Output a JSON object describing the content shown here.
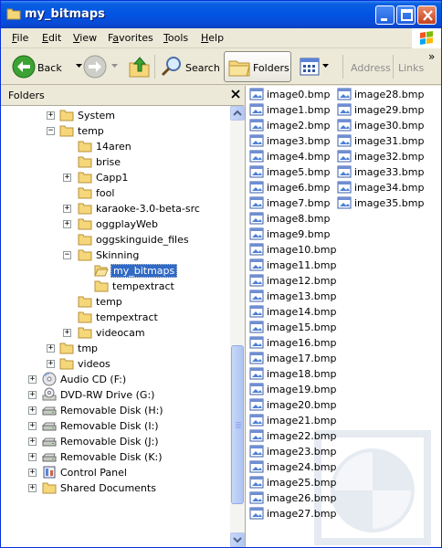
{
  "window": {
    "title": "my_bitmaps"
  },
  "menu": {
    "items": [
      {
        "u": "F",
        "rest": "ile"
      },
      {
        "u": "E",
        "rest": "dit"
      },
      {
        "u": "V",
        "rest": "iew"
      },
      {
        "u": "",
        "pre": "F",
        "u2": "a",
        "rest": "vorites"
      },
      {
        "u": "T",
        "rest": "ools"
      },
      {
        "u": "H",
        "rest": "elp"
      }
    ]
  },
  "toolbar": {
    "back": "Back",
    "search": "Search",
    "folders": "Folders",
    "address": "Address",
    "links": "Links",
    "chevron": "»"
  },
  "panel": {
    "title": "Folders",
    "close": "×"
  },
  "tree": [
    {
      "label": "System",
      "exp": "+"
    },
    {
      "label": "temp",
      "exp": "−"
    },
    {
      "label": "14aren",
      "exp": ""
    },
    {
      "label": "brise",
      "exp": ""
    },
    {
      "label": "Capp1",
      "exp": "+"
    },
    {
      "label": "fool",
      "exp": ""
    },
    {
      "label": "karaoke-3.0-beta-src",
      "exp": "+"
    },
    {
      "label": "oggplayWeb",
      "exp": "+"
    },
    {
      "label": "oggskinguide_files",
      "exp": ""
    },
    {
      "label": "Skinning",
      "exp": "−"
    },
    {
      "label": "my_bitmaps",
      "exp": "",
      "selected": true
    },
    {
      "label": "tempextract",
      "exp": ""
    },
    {
      "label": "temp",
      "exp": ""
    },
    {
      "label": "tempextract",
      "exp": ""
    },
    {
      "label": "videocam",
      "exp": "+"
    },
    {
      "label": "tmp",
      "exp": "+"
    },
    {
      "label": "videos",
      "exp": "+"
    },
    {
      "label": "Audio CD (F:)",
      "exp": "+",
      "icon": "cd"
    },
    {
      "label": "DVD-RW Drive (G:)",
      "exp": "+",
      "icon": "dvd"
    },
    {
      "label": "Removable Disk (H:)",
      "exp": "+",
      "icon": "disk"
    },
    {
      "label": "Removable Disk (I:)",
      "exp": "+",
      "icon": "disk"
    },
    {
      "label": "Removable Disk (J:)",
      "exp": "+",
      "icon": "disk"
    },
    {
      "label": "Removable Disk (K:)",
      "exp": "+",
      "icon": "disk"
    },
    {
      "label": "Control Panel",
      "exp": "+",
      "icon": "cpl"
    },
    {
      "label": "Shared Documents",
      "exp": "+",
      "icon": "folder"
    }
  ],
  "files": {
    "col1": [
      "image0.bmp",
      "image1.bmp",
      "image2.bmp",
      "image3.bmp",
      "image4.bmp",
      "image5.bmp",
      "image6.bmp",
      "image7.bmp",
      "image8.bmp",
      "image9.bmp",
      "image10.bmp",
      "image11.bmp",
      "image12.bmp",
      "image13.bmp",
      "image14.bmp",
      "image15.bmp",
      "image16.bmp",
      "image17.bmp",
      "image18.bmp",
      "image19.bmp",
      "image20.bmp",
      "image21.bmp",
      "image22.bmp",
      "image23.bmp",
      "image24.bmp",
      "image25.bmp",
      "image26.bmp",
      "image27.bmp"
    ],
    "col2": [
      "image28.bmp",
      "image29.bmp",
      "image30.bmp",
      "image31.bmp",
      "image32.bmp",
      "image33.bmp",
      "image34.bmp",
      "image35.bmp"
    ]
  },
  "colors": {
    "titlebar": "#0054e3",
    "selection": "#316ac5",
    "folder": "#f5d77a"
  }
}
